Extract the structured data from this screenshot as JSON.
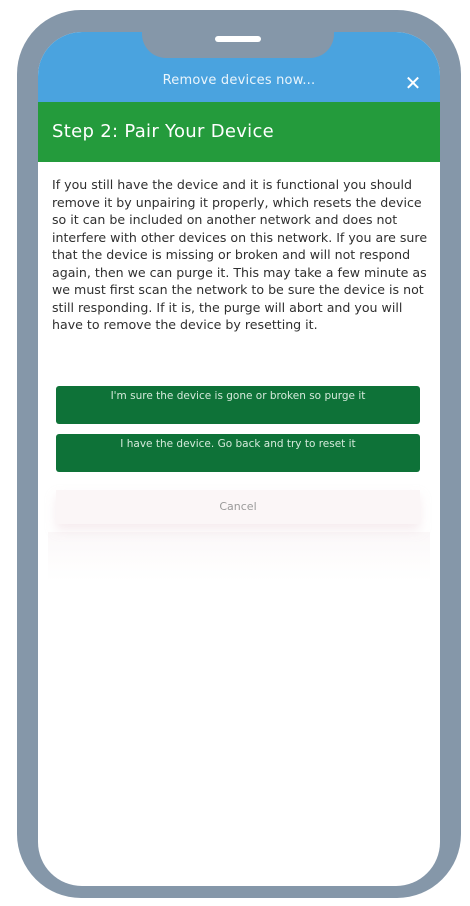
{
  "dialog": {
    "title": "Remove devices now...",
    "close_glyph": "✕"
  },
  "step": {
    "title": "Step 2: Pair Your Device"
  },
  "body": {
    "text": "If you still have the device and it is functional you should remove it by unpairing it properly, which resets the device so it can be included on another network and does not interfere with other devices on this network.  If you are sure that the device is missing or broken and will not respond again, then we can purge it.  This may take a few minute as we must first scan the network to be sure the device is not still responding.  If it is, the purge will abort and you will have to remove the device by resetting it."
  },
  "actions": {
    "purge_label": "I'm sure the device is gone or broken so purge it",
    "back_label": "I have the device.  Go back and try to reset it",
    "cancel_label": "Cancel"
  },
  "colors": {
    "frame": "#8597a9",
    "top_bar": "#4aa3df",
    "step_header": "#249b3c",
    "action_button": "#0e7238"
  }
}
